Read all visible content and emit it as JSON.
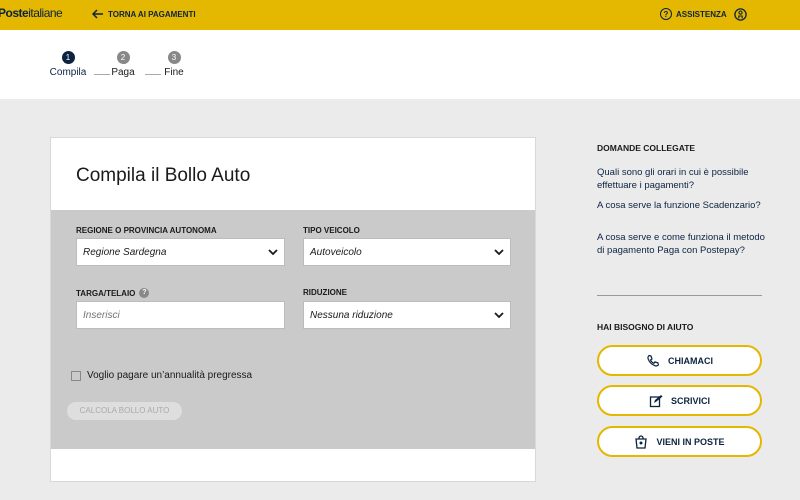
{
  "header": {
    "logo_bold": "Poste",
    "logo_light": "italiane",
    "back_label": "TORNA AI PAGAMENTI",
    "assist_label": "ASSISTENZA"
  },
  "stepper": {
    "steps": [
      {
        "num": "1",
        "label": "Compila",
        "state": "active"
      },
      {
        "num": "2",
        "label": "Paga",
        "state": "inactive"
      },
      {
        "num": "3",
        "label": "Fine",
        "state": "inactive"
      }
    ]
  },
  "form": {
    "title": "Compila il Bollo Auto",
    "regione": {
      "label": "REGIONE O PROVINCIA AUTONOMA",
      "value": "Regione Sardegna"
    },
    "tipo": {
      "label": "TIPO VEICOLO",
      "value": "Autoveicolo"
    },
    "targa": {
      "label": "TARGA/TELAIO",
      "placeholder": "Inserisci",
      "help": "?"
    },
    "riduzione": {
      "label": "RIDUZIONE",
      "value": "Nessuna riduzione"
    },
    "checkbox_label": "Voglio pagare un’annualità pregressa",
    "submit_label": "CALCOLA BOLLO AUTO"
  },
  "sidebar": {
    "faq_title": "DOMANDE COLLEGATE",
    "faq": [
      "Quali sono gli orari in cui è possibile effettuare i pagamenti?",
      "A cosa serve la funzione Scadenzario?",
      "A cosa serve e come funziona il metodo di pagamento Paga con Postepay?"
    ],
    "help_title": "HAI BISOGNO DI AIUTO",
    "call_label": "CHIAMACI",
    "write_label": "SCRIVICI",
    "visit_label": "VIENI IN POSTE"
  },
  "colors": {
    "brand_yellow": "#e4b700",
    "brand_navy": "#0c2340"
  }
}
